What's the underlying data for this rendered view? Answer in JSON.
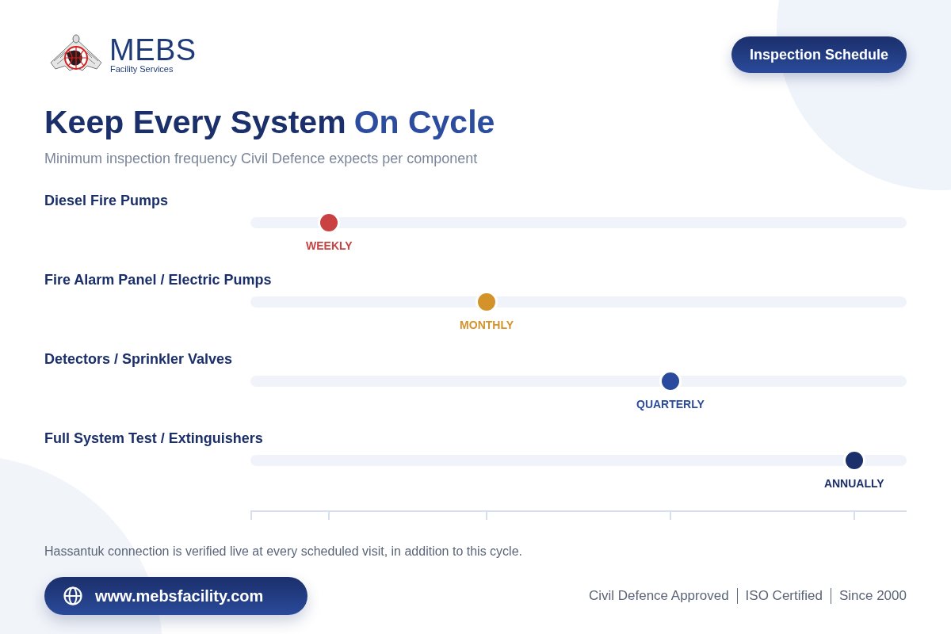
{
  "logo": {
    "name": "MEBS",
    "tagline": "Facility Services"
  },
  "badge": "Inspection Schedule",
  "title": {
    "lead": "Keep Every System",
    "highlight": "On Cycle"
  },
  "subtitle": "Minimum inspection frequency Civil Defence expects per component",
  "rows": [
    {
      "label": "Diesel Fire Pumps",
      "frequency": "WEEKLY",
      "level": 0.12,
      "color": "#c94141"
    },
    {
      "label": "Fire Alarm Panel / Electric Pumps",
      "frequency": "MONTHLY",
      "level": 0.36,
      "color": "#d4922a"
    },
    {
      "label": "Detectors / Sprinkler Valves",
      "frequency": "QUARTERLY",
      "level": 0.64,
      "color": "#2b4a9e"
    },
    {
      "label": "Full System Test / Extinguishers",
      "frequency": "ANNUALLY",
      "level": 0.92,
      "color": "#1b2f6b"
    }
  ],
  "note": "Hassantuk connection is verified live at every scheduled visit, in addition to this cycle.",
  "website": "www.mebsfacility.com",
  "credentials": [
    "Civil Defence Approved",
    "ISO Certified",
    "Since 2000"
  ]
}
